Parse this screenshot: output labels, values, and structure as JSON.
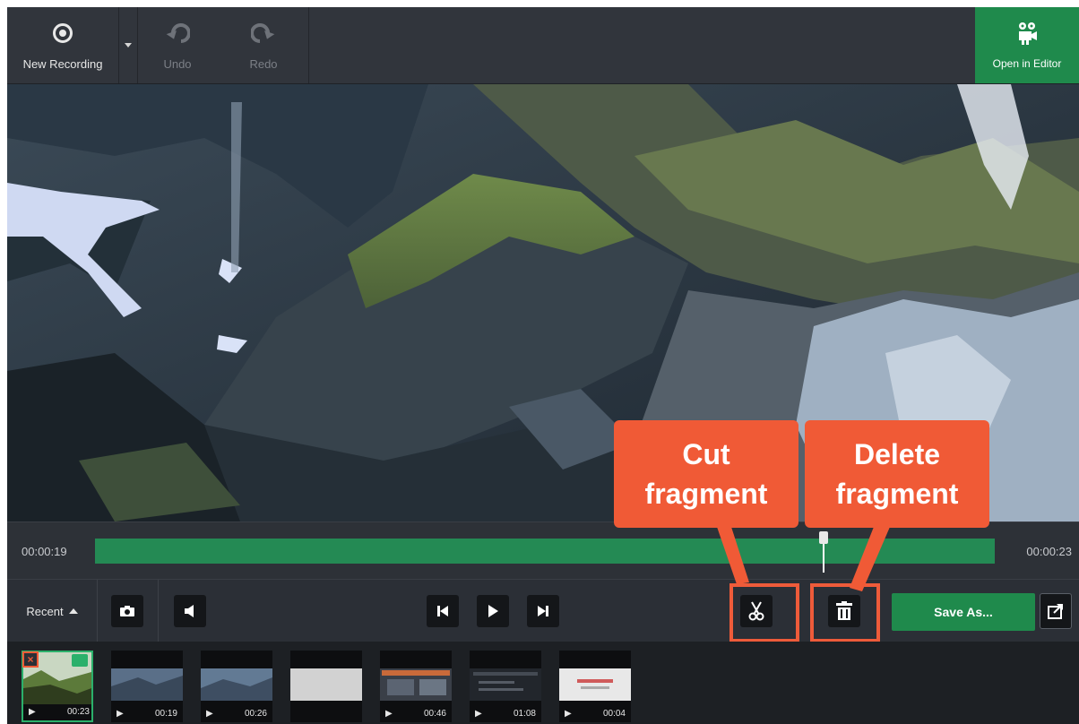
{
  "toolbar": {
    "new_recording_label": "New Recording",
    "undo_label": "Undo",
    "redo_label": "Redo",
    "open_in_editor_label": "Open in Editor"
  },
  "timeline": {
    "current_time": "00:00:19",
    "end_time": "00:00:23",
    "playhead_progress": 0.81
  },
  "controls": {
    "recent_label": "Recent",
    "save_as_label": "Save As..."
  },
  "thumbnails": [
    {
      "duration": "00:23",
      "selected": true
    },
    {
      "duration": "00:19"
    },
    {
      "duration": "00:26"
    },
    {
      "duration": ""
    },
    {
      "duration": "00:46"
    },
    {
      "duration": "01:08"
    },
    {
      "duration": "00:04"
    }
  ],
  "callouts": {
    "cut": "Cut\nfragment",
    "delete": "Delete\nfragment"
  },
  "colors": {
    "accent_green": "#1f8a4c",
    "callout_orange": "#f05a36"
  }
}
